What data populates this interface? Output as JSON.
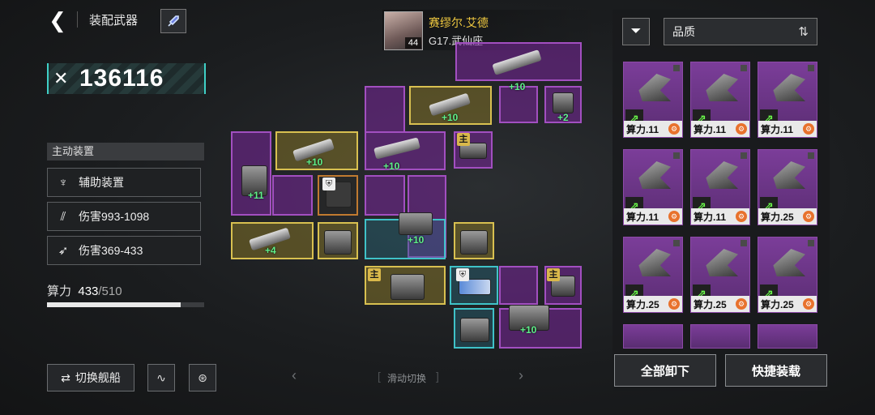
{
  "header": {
    "title": "装配武器",
    "back_icon": "chevron-left-icon",
    "rocket_icon": "rocket-icon"
  },
  "power": {
    "value": "136116",
    "icon": "crossed-swords-icon"
  },
  "section": {
    "title": "主动装置",
    "slots": [
      {
        "icon": "drone-icon",
        "label": "辅助装置"
      },
      {
        "icon": "claw-icon",
        "label": "伤害993-1098"
      },
      {
        "icon": "missile-icon",
        "label": "伤害369-433"
      }
    ]
  },
  "capacity": {
    "label": "算力",
    "used": "433",
    "total": "/510",
    "fraction": 0.849
  },
  "buttons": {
    "switch_ship": "切换舰船",
    "switch_icon": "swap-icon",
    "wave_icon": "wave-icon",
    "target_icon": "target-icon"
  },
  "pilot": {
    "name": "赛缪尔.艾德",
    "ship": "G17.武仙座",
    "level": "44"
  },
  "grid": {
    "plus": [
      "+10",
      "+2",
      "+10",
      "+10",
      "+11",
      "+4",
      "+10",
      "+10",
      "+10"
    ],
    "main_badge": "主"
  },
  "swipe": {
    "label": "滑动切换"
  },
  "right": {
    "sort_label": "品质",
    "filter_icon": "filter-icon",
    "sort_icon": "sort-arrows-icon",
    "items": [
      "算力.11",
      "算力.11",
      "算力.11",
      "算力.11",
      "算力.11",
      "算力.25",
      "算力.25",
      "算力.25",
      "算力.25"
    ],
    "unload_all": "全部卸下",
    "quick_equip": "快捷装载"
  },
  "colors": {
    "accent": "#3fd0c6",
    "epic": "#8d4aa8",
    "gold": "#d8c050",
    "plus": "#5ff08a"
  }
}
